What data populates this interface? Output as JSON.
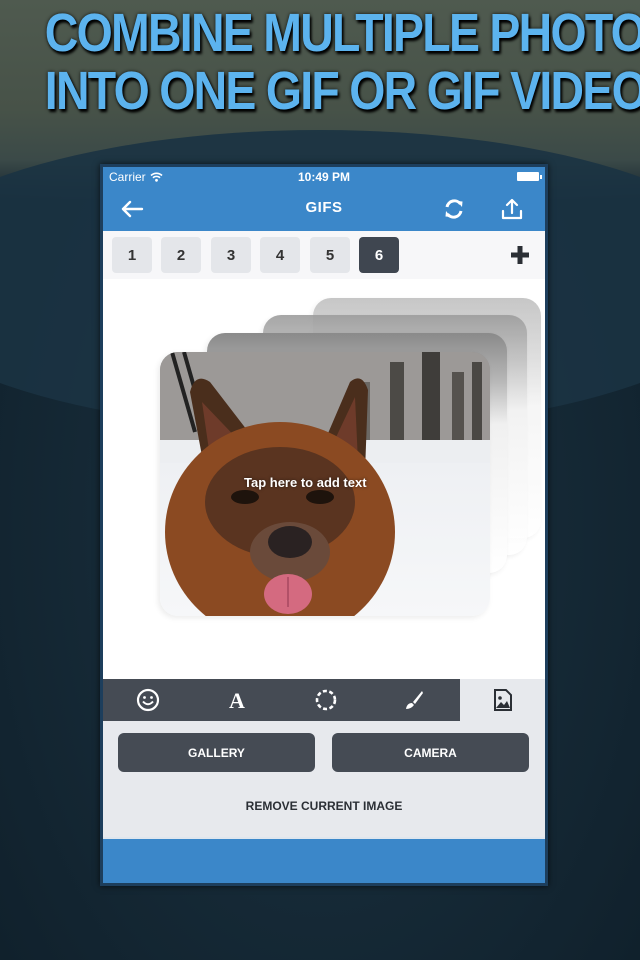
{
  "headline": {
    "line1": "COMBINE MULTIPLE PHOTOS",
    "line2": "INTO ONE GIF OR GIF VIDEO"
  },
  "status_bar": {
    "carrier": "Carrier",
    "time": "10:49 PM",
    "wifi_icon": "wifi-icon",
    "battery_icon": "battery-icon"
  },
  "navbar": {
    "title": "GIFS",
    "back_icon": "arrow-left-icon",
    "refresh_icon": "refresh-icon",
    "share_icon": "share-upload-icon"
  },
  "frames": {
    "tabs": [
      "1",
      "2",
      "3",
      "4",
      "5",
      "6"
    ],
    "active_index": 5,
    "add_icon": "plus-icon"
  },
  "canvas": {
    "overlay_text": "Tap here to add text",
    "stacked_images_count": 4
  },
  "toolbar": {
    "tools": [
      {
        "name": "sticker",
        "icon": "smiley-icon"
      },
      {
        "name": "text",
        "icon": "letter-a-icon"
      },
      {
        "name": "shape",
        "icon": "dashed-circle-icon"
      },
      {
        "name": "brush",
        "icon": "paintbrush-icon"
      },
      {
        "name": "image",
        "icon": "image-file-icon"
      }
    ],
    "active_tool": "image"
  },
  "panel": {
    "gallery_label": "GALLERY",
    "camera_label": "CAMERA",
    "remove_label": "REMOVE CURRENT IMAGE"
  },
  "colors": {
    "brand_blue": "#3b87c9",
    "dark_button": "#454b54",
    "headline_blue": "#5cb3ee",
    "panel_bg": "#e7e9ed"
  }
}
